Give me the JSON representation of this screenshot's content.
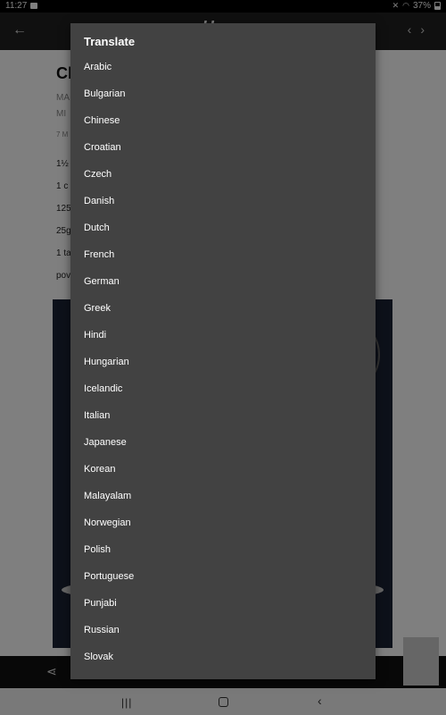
{
  "status_bar": {
    "time": "11:27",
    "battery": "37%"
  },
  "background_app": {
    "title_partial": "Cl",
    "meta_lines": [
      "MA",
      "MI",
      "7 M"
    ],
    "ingredient_lines": [
      "1½",
      "1 c",
      "125",
      "25g",
      "1 ta",
      "pov"
    ]
  },
  "dialog": {
    "title": "Translate",
    "languages": [
      "Arabic",
      "Bulgarian",
      "Chinese",
      "Croatian",
      "Czech",
      "Danish",
      "Dutch",
      "French",
      "German",
      "Greek",
      "Hindi",
      "Hungarian",
      "Icelandic",
      "Italian",
      "Japanese",
      "Korean",
      "Malayalam",
      "Norwegian",
      "Polish",
      "Portuguese",
      "Punjabi",
      "Russian",
      "Slovak"
    ]
  },
  "colors": {
    "dialog_bg": "#424242",
    "scrim": "rgba(0,0,0,0.5)",
    "text": "#ffffff"
  }
}
